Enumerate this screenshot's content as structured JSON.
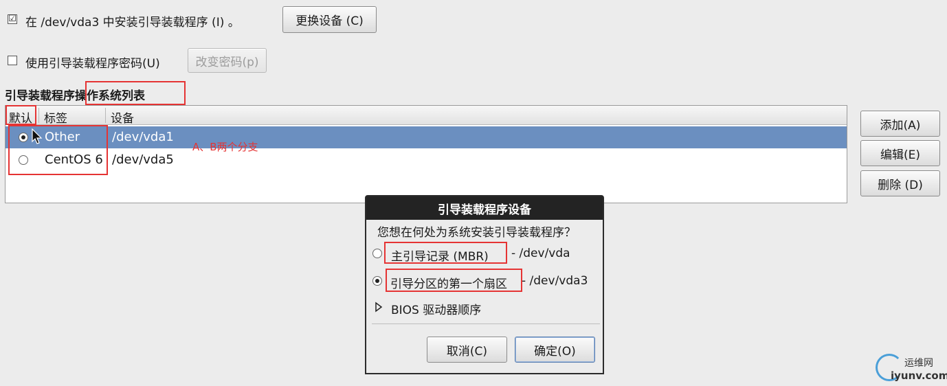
{
  "install_checkbox": {
    "checked_glyph": "☑",
    "label": "在 /dev/vda3 中安装引导装载程序 (I) 。"
  },
  "change_device_button": "更换设备 (C)",
  "password_checkbox": {
    "label": "使用引导装载程序密码(U)"
  },
  "change_password_button": "改变密码(p)",
  "os_list_title": {
    "part1": "引导装载程序",
    "part2": "操作系统列表"
  },
  "table": {
    "headers": [
      "默认",
      "标签",
      "设备"
    ],
    "rows": [
      {
        "label": "Other",
        "device": "/dev/vda1",
        "default": true,
        "selected": true
      },
      {
        "label": "CentOS 6",
        "device": "/dev/vda5",
        "default": false,
        "selected": false
      }
    ]
  },
  "annotation": "A、B两个分支",
  "side_buttons": {
    "add": "添加(A)",
    "edit": "编辑(E)",
    "delete": "删除 (D)"
  },
  "dialog": {
    "title": "引导装载程序设备",
    "question": "您想在何处为系统安装引导装载程序？",
    "option_mbr": {
      "label": "主引导记录 (MBR)",
      "device": "- /dev/vda",
      "selected": false
    },
    "option_partition": {
      "label": "引导分区的第一个扇区",
      "device": "- /dev/vda3",
      "selected": true
    },
    "bios_expander": "BIOS 驱动器顺序",
    "cancel": "取消(C)",
    "ok": "确定(O)"
  },
  "watermark": {
    "name": "运维网",
    "domain": "iyunv.com"
  },
  "colors": {
    "selection": "#6b8fc0",
    "highlight_box": "#e53333",
    "annotation": "#e53333"
  }
}
